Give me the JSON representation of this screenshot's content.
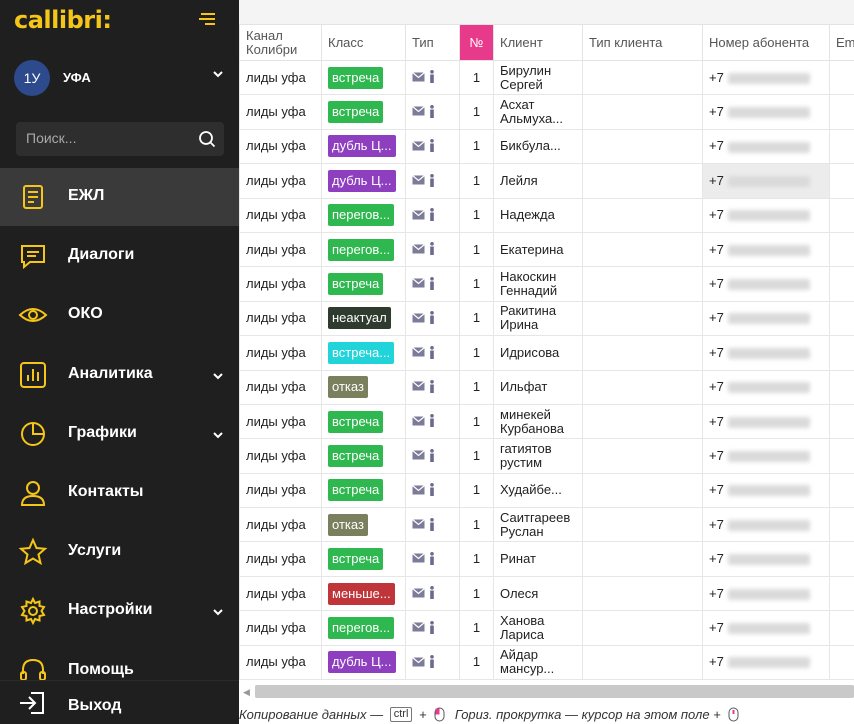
{
  "app": {
    "logo_text": "callibri:",
    "brand_color": "#f5c518"
  },
  "account": {
    "avatar": "1У",
    "name": "УФА"
  },
  "search": {
    "placeholder": "Поиск..."
  },
  "nav": {
    "items": [
      {
        "label": "ЕЖЛ",
        "icon": "journal-icon",
        "active": true
      },
      {
        "label": "Диалоги",
        "icon": "chat-icon"
      },
      {
        "label": "ОКО",
        "icon": "eye-icon"
      },
      {
        "label": "Аналитика",
        "icon": "bar-chart-icon",
        "expandable": true
      },
      {
        "label": "Графики",
        "icon": "pie-chart-icon",
        "expandable": true
      },
      {
        "label": "Контакты",
        "icon": "person-icon"
      },
      {
        "label": "Услуги",
        "icon": "star-icon"
      },
      {
        "label": "Настройки",
        "icon": "gear-icon",
        "expandable": true
      },
      {
        "label": "Помощь",
        "icon": "headset-icon"
      }
    ],
    "logout_label": "Выход"
  },
  "table": {
    "columns": [
      "Канал Колибри",
      "Класс",
      "Тип",
      "№",
      "Клиент",
      "Тип клиента",
      "Номер абонента",
      "Em"
    ],
    "rows": [
      {
        "channel": "лиды уфа",
        "class": "встреча",
        "class_color": "#2fb84f",
        "num": "1",
        "client": "Бирулин Сергей",
        "phone_prefix": "+7"
      },
      {
        "channel": "лиды уфа",
        "class": "встреча",
        "class_color": "#2fb84f",
        "num": "1",
        "client": "Асхат Альмуха...",
        "phone_prefix": "+7"
      },
      {
        "channel": "лиды уфа",
        "class": "дубль Ц...",
        "class_color": "#8e3fc0",
        "num": "1",
        "client": "Бикбула...",
        "phone_prefix": "+7"
      },
      {
        "channel": "лиды уфа",
        "class": "дубль Ц...",
        "class_color": "#8e3fc0",
        "num": "1",
        "client": "Лейля",
        "phone_prefix": "+7"
      },
      {
        "channel": "лиды уфа",
        "class": "перегов...",
        "class_color": "#2fb84f",
        "num": "1",
        "client": "Надежда",
        "phone_prefix": "+7"
      },
      {
        "channel": "лиды уфа",
        "class": "перегов...",
        "class_color": "#2fb84f",
        "num": "1",
        "client": "Екатерина",
        "phone_prefix": "+7"
      },
      {
        "channel": "лиды уфа",
        "class": "встреча",
        "class_color": "#2fb84f",
        "num": "1",
        "client": "Накоскин Геннадий",
        "phone_prefix": "+7"
      },
      {
        "channel": "лиды уфа",
        "class": "неактуал",
        "class_color": "#2e3b2e",
        "num": "1",
        "client": "Ракитина Ирина",
        "phone_prefix": "+7"
      },
      {
        "channel": "лиды уфа",
        "class": "встреча...",
        "class_color": "#21d4d9",
        "num": "1",
        "client": "Идрисова",
        "phone_prefix": "+7"
      },
      {
        "channel": "лиды уфа",
        "class": "отказ",
        "class_color": "#7a7f5e",
        "num": "1",
        "client": "Ильфат",
        "phone_prefix": "+7"
      },
      {
        "channel": "лиды уфа",
        "class": "встреча",
        "class_color": "#2fb84f",
        "num": "1",
        "client": "минекей Курбанова",
        "phone_prefix": "+7"
      },
      {
        "channel": "лиды уфа",
        "class": "встреча",
        "class_color": "#2fb84f",
        "num": "1",
        "client": "гатиятов рустим",
        "phone_prefix": "+7"
      },
      {
        "channel": "лиды уфа",
        "class": "встреча",
        "class_color": "#2fb84f",
        "num": "1",
        "client": "Худайбе...",
        "phone_prefix": "+7"
      },
      {
        "channel": "лиды уфа",
        "class": "отказ",
        "class_color": "#7a7f5e",
        "num": "1",
        "client": "Саитгареев Руслан",
        "phone_prefix": "+7"
      },
      {
        "channel": "лиды уфа",
        "class": "встреча",
        "class_color": "#2fb84f",
        "num": "1",
        "client": "Ринат",
        "phone_prefix": "+7"
      },
      {
        "channel": "лиды уфа",
        "class": "меньше...",
        "class_color": "#c0353a",
        "num": "1",
        "client": "Олеся",
        "phone_prefix": "+7"
      },
      {
        "channel": "лиды уфа",
        "class": "перегов...",
        "class_color": "#2fb84f",
        "num": "1",
        "client": "Ханова Лариса",
        "phone_prefix": "+7"
      },
      {
        "channel": "лиды уфа",
        "class": "дубль Ц...",
        "class_color": "#8e3fc0",
        "num": "1",
        "client": "Айдар мансур...",
        "phone_prefix": "+7"
      }
    ]
  },
  "footer": {
    "copy_text": "Копирование данных —",
    "ctrl_key": "ctrl",
    "plus": "+",
    "scroll_text": "Гориз. прокрутка — курсор на этом поле +"
  }
}
